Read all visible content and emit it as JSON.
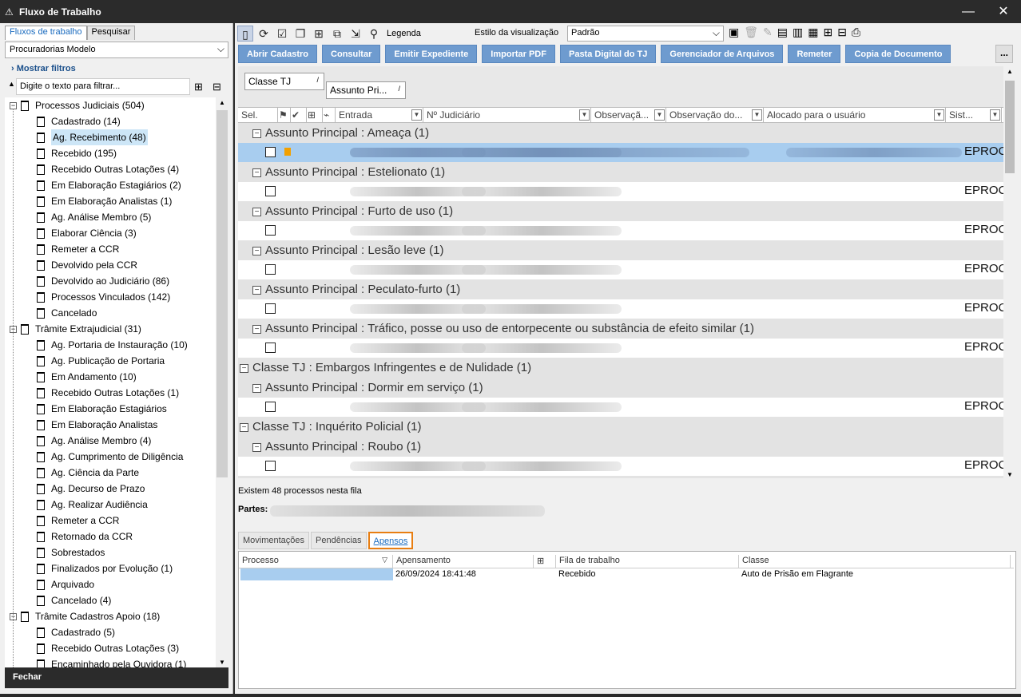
{
  "window": {
    "title": "Fluxo de Trabalho",
    "minimize": "—",
    "close": "✕"
  },
  "left": {
    "tabs": [
      "Fluxos de trabalho",
      "Pesquisar"
    ],
    "procuradoria": "Procuradorias Modelo",
    "mostrar_filtros": "Mostrar filtros",
    "filter_placeholder": "Digite o texto para filtrar...",
    "tree": [
      {
        "label": "Processos Judiciais (504)",
        "level": 0
      },
      {
        "label": "Cadastrado (14)",
        "level": 1
      },
      {
        "label": "Ag. Recebimento (48)",
        "level": 1,
        "selected": true
      },
      {
        "label": "Recebido (195)",
        "level": 1
      },
      {
        "label": "Recebido Outras Lotações (4)",
        "level": 1
      },
      {
        "label": "Em Elaboração Estagiários (2)",
        "level": 1
      },
      {
        "label": "Em Elaboração Analistas (1)",
        "level": 1
      },
      {
        "label": "Ag. Análise Membro (5)",
        "level": 1
      },
      {
        "label": "Elaborar Ciência (3)",
        "level": 1
      },
      {
        "label": "Remeter a CCR",
        "level": 1
      },
      {
        "label": "Devolvido pela CCR",
        "level": 1
      },
      {
        "label": "Devolvido ao Judiciário (86)",
        "level": 1
      },
      {
        "label": "Processos Vinculados (142)",
        "level": 1
      },
      {
        "label": "Cancelado",
        "level": 1
      },
      {
        "label": "Trâmite Extrajudicial (31)",
        "level": 0
      },
      {
        "label": "Ag. Portaria de Instauração (10)",
        "level": 1
      },
      {
        "label": "Ag. Publicação de Portaria",
        "level": 1
      },
      {
        "label": "Em Andamento (10)",
        "level": 1
      },
      {
        "label": "Recebido Outras Lotações (1)",
        "level": 1
      },
      {
        "label": "Em Elaboração Estagiários",
        "level": 1
      },
      {
        "label": "Em Elaboração Analistas",
        "level": 1
      },
      {
        "label": "Ag. Análise Membro (4)",
        "level": 1
      },
      {
        "label": "Ag. Cumprimento de Diligência",
        "level": 1
      },
      {
        "label": "Ag. Ciência da Parte",
        "level": 1
      },
      {
        "label": "Ag. Decurso de Prazo",
        "level": 1
      },
      {
        "label": "Ag. Realizar Audiência",
        "level": 1
      },
      {
        "label": "Remeter a CCR",
        "level": 1
      },
      {
        "label": "Retornado da CCR",
        "level": 1
      },
      {
        "label": "Sobrestados",
        "level": 1
      },
      {
        "label": "Finalizados por Evolução (1)",
        "level": 1
      },
      {
        "label": "Arquivado",
        "level": 1
      },
      {
        "label": "Cancelado (4)",
        "level": 1
      },
      {
        "label": "Trâmite Cadastros Apoio (18)",
        "level": 0
      },
      {
        "label": "Cadastrado (5)",
        "level": 1
      },
      {
        "label": "Recebido Outras Lotações (3)",
        "level": 1
      },
      {
        "label": "Encaminhado pela Ouvidora (1)",
        "level": 1
      }
    ],
    "fechar": "Fechar"
  },
  "toolbar": {
    "legenda": "Legenda",
    "estilo_label": "Estilo da visualização",
    "estilo_value": "Padrão"
  },
  "actions": [
    "Abrir Cadastro",
    "Consultar",
    "Emitir Expediente",
    "Importar PDF",
    "Pasta Digital do TJ",
    "Gerenciador de Arquivos",
    "Remeter",
    "Copia de Documento"
  ],
  "more": "...",
  "grouping": [
    "Classe TJ",
    "Assunto Pri..."
  ],
  "columns": [
    "Sel.",
    "",
    "",
    "",
    "",
    "Entrada",
    "Nº Judiciário",
    "Observaçã...",
    "Observação do...",
    "Alocado para o usuário",
    "Sist..."
  ],
  "groups": [
    {
      "label": "Assunto Principal : Ameaça  (1)",
      "level": 1,
      "row_selected": true,
      "flag": true,
      "sistema": "EPROC"
    },
    {
      "label": "Assunto Principal : Estelionato  (1)",
      "level": 1,
      "sistema": "EPROC"
    },
    {
      "label": "Assunto Principal : Furto de uso  (1)",
      "level": 1,
      "sistema": "EPROC"
    },
    {
      "label": "Assunto Principal : Lesão leve  (1)",
      "level": 1,
      "sistema": "EPROC"
    },
    {
      "label": "Assunto Principal : Peculato-furto  (1)",
      "level": 1,
      "sistema": "EPROC"
    },
    {
      "label": "Assunto Principal : Tráfico, posse ou uso de entorpecente ou substância de efeito similar  (1)",
      "level": 1,
      "sistema": "EPROC"
    },
    {
      "label": "Classe TJ : Embargos Infringentes e de Nulidade  (1)",
      "level": 0
    },
    {
      "label": "Assunto Principal : Dormir em serviço  (1)",
      "level": 1,
      "sistema": "EPROC"
    },
    {
      "label": "Classe TJ : Inquérito Policial  (1)",
      "level": 0
    },
    {
      "label": "Assunto Principal : Roubo  (1)",
      "level": 1,
      "sistema": "EPROC"
    }
  ],
  "status": "Existem 48 processos nesta fila",
  "partes_label": "Partes:",
  "bottom_tabs": [
    "Movimentações",
    "Pendências",
    "Apensos"
  ],
  "apensos": {
    "headers": [
      "Processo",
      "Apensamento",
      "",
      "Fila de trabalho",
      "Classe"
    ],
    "rows": [
      {
        "apensamento": "26/09/2024 18:41:48",
        "fila": "Recebido",
        "classe": "Auto de Prisão em Flagrante"
      }
    ]
  }
}
